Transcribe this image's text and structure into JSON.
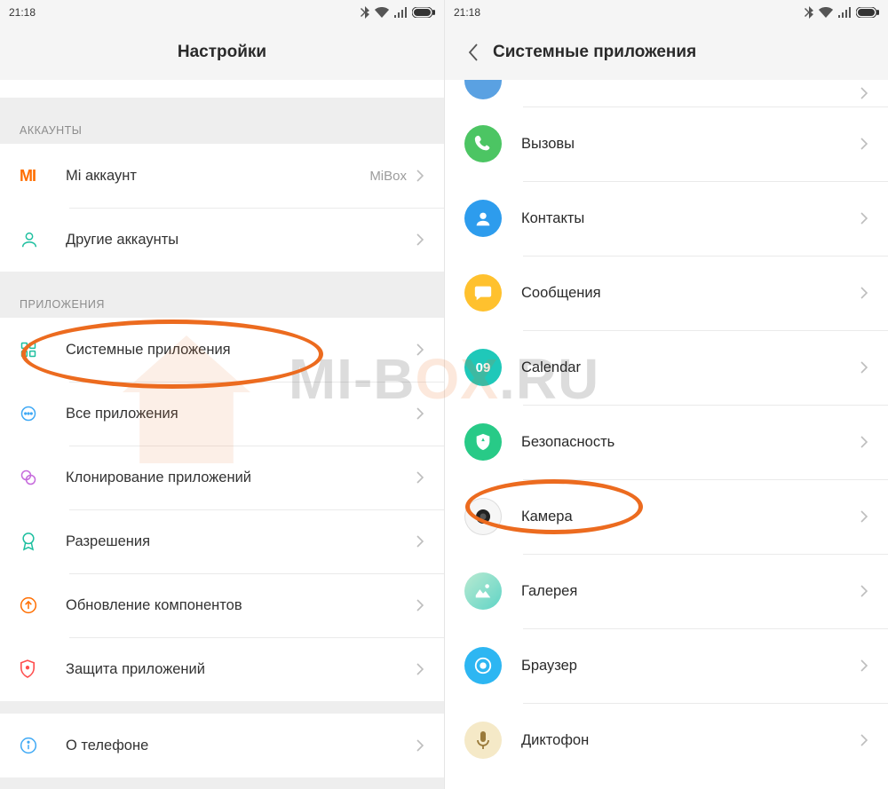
{
  "status": {
    "time": "21:18"
  },
  "left": {
    "title": "Настройки",
    "sections": {
      "accounts_header": "АККАУНТЫ",
      "apps_header": "ПРИЛОЖЕНИЯ"
    },
    "rows": {
      "mi_account": {
        "label": "Mi аккаунт",
        "value": "MiBox"
      },
      "other_accounts": {
        "label": "Другие аккаунты"
      },
      "system_apps": {
        "label": "Системные приложения"
      },
      "all_apps": {
        "label": "Все приложения"
      },
      "clone_apps": {
        "label": "Клонирование приложений"
      },
      "permissions": {
        "label": "Разрешения"
      },
      "component_update": {
        "label": "Обновление компонентов"
      },
      "app_protect": {
        "label": "Защита приложений"
      },
      "about_phone": {
        "label": "О телефоне"
      }
    }
  },
  "right": {
    "title": "Системные приложения",
    "apps": {
      "calls": "Вызовы",
      "contacts": "Контакты",
      "messages": "Сообщения",
      "calendar": "Calendar",
      "calendar_day": "09",
      "security": "Безопасность",
      "camera": "Камера",
      "gallery": "Галерея",
      "browser": "Браузер",
      "recorder": "Диктофон"
    }
  },
  "watermark": {
    "part1": "MI-B",
    "part2": "OX",
    "part3": ".RU"
  }
}
